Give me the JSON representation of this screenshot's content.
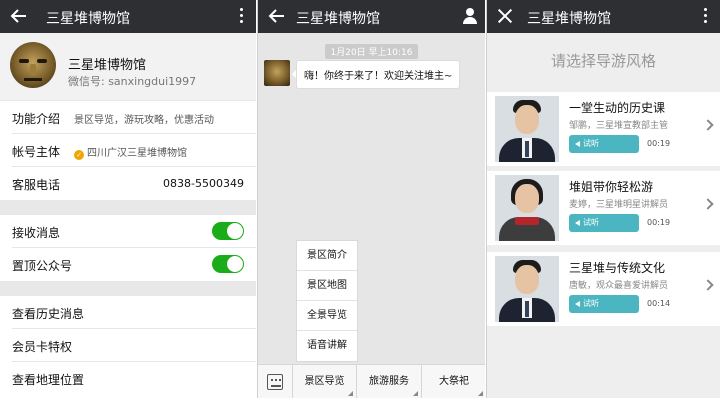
{
  "account": {
    "name": "三星堆博物馆",
    "wechat_id": "微信号: sanxingdui1997"
  },
  "profile_panel": {
    "top_title": "三星堆博物馆",
    "info_rows": [
      {
        "label": "功能介绍",
        "value": "景区导览，游玩攻略，优惠活动"
      },
      {
        "label": "帐号主体",
        "value": "四川广汉三星堆博物馆"
      },
      {
        "label": "客服电话",
        "value": "0838-5500349"
      }
    ],
    "toggle_rows": [
      {
        "label": "接收消息",
        "on": true
      },
      {
        "label": "置顶公众号",
        "on": true
      }
    ],
    "link_rows": [
      {
        "label": "查看历史消息"
      },
      {
        "label": "会员卡特权"
      },
      {
        "label": "查看地理位置"
      }
    ]
  },
  "chat_panel": {
    "top_title": "三星堆博物馆",
    "timestamp": "1月20日 早上10:16",
    "message": "嗨！你终于来了！欢迎关注堆主~",
    "popup_menu": [
      "景区简介",
      "景区地图",
      "全景导览",
      "语音讲解"
    ],
    "bottom_tabs": [
      "景区导览",
      "旅游服务",
      "大祭祀"
    ]
  },
  "guide_panel": {
    "top_title": "三星堆博物馆",
    "heading": "请选择导游风格",
    "audio_label": "试听",
    "cards": [
      {
        "title": "一堂生动的历史课",
        "desc": "邹鹏，三星堆宣教部主管",
        "duration": "00:19"
      },
      {
        "title": "堆姐带你轻松游",
        "desc": "麦婷，三星堆明星讲解员",
        "duration": "00:19"
      },
      {
        "title": "三星堆与传统文化",
        "desc": "唐敏，观众最喜爱讲解员",
        "duration": "00:14"
      }
    ]
  },
  "colors": {
    "top_bar": "#2d2f33",
    "toggle_on": "#1aac19",
    "audio_button": "#4bb6c1",
    "verified_badge": "#f0a500"
  }
}
